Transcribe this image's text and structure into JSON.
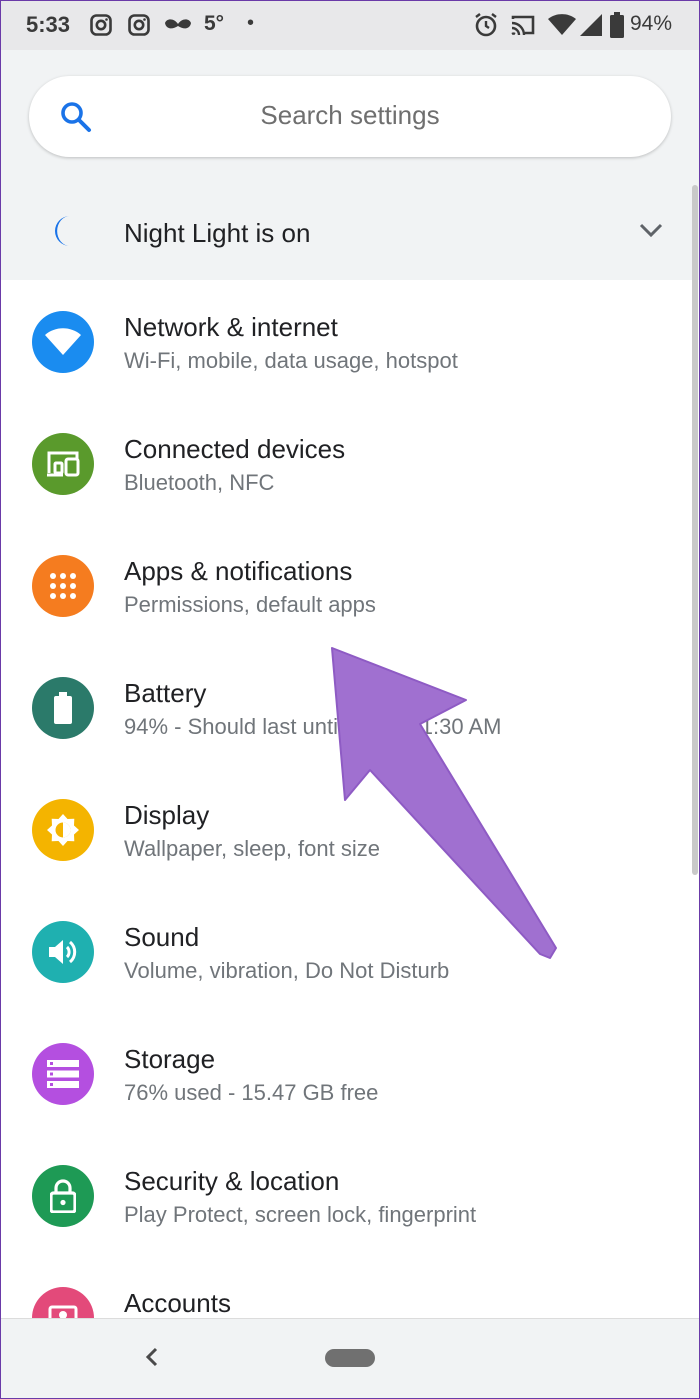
{
  "status_bar": {
    "time": "5:33",
    "temperature": "5°",
    "dot": "•",
    "battery": "94%",
    "icons_left": [
      "instagram-icon",
      "instagram-icon",
      "mustache-icon"
    ],
    "icons_right": [
      "alarm-icon",
      "cast-icon",
      "wifi-icon",
      "cellular-signal-icon",
      "battery-icon"
    ]
  },
  "search": {
    "placeholder": "Search settings",
    "icon": "search-icon"
  },
  "night_light": {
    "label": "Night Light is on",
    "icon": "moon-icon",
    "expand_icon": "chevron-down-icon",
    "accent": "#1a73e8"
  },
  "settings": [
    {
      "title": "Network & internet",
      "subtitle": "Wi-Fi, mobile, data usage, hotspot",
      "icon": "wifi-icon",
      "color": "#1a8cf0"
    },
    {
      "title": "Connected devices",
      "subtitle": "Bluetooth, NFC",
      "icon": "devices-icon",
      "color": "#5a9a2c"
    },
    {
      "title": "Apps & notifications",
      "subtitle": "Permissions, default apps",
      "icon": "apps-grid-icon",
      "color": "#f57c1f"
    },
    {
      "title": "Battery",
      "subtitle": "94% - Should last until about 11:30 AM",
      "icon": "battery-icon",
      "color": "#2b7a6a"
    },
    {
      "title": "Display",
      "subtitle": "Wallpaper, sleep, font size",
      "icon": "brightness-icon",
      "color": "#f4b400"
    },
    {
      "title": "Sound",
      "subtitle": "Volume, vibration, Do Not Disturb",
      "icon": "volume-icon",
      "color": "#1fb0b0"
    },
    {
      "title": "Storage",
      "subtitle": "76% used - 15.47 GB free",
      "icon": "storage-icon",
      "color": "#b44fe0"
    },
    {
      "title": "Security & location",
      "subtitle": "Play Protect, screen lock, fingerprint",
      "icon": "lock-icon",
      "color": "#1e9a55"
    },
    {
      "title": "Accounts",
      "subtitle": "",
      "icon": "account-icon",
      "color": "#e34a7a"
    }
  ],
  "annotation": {
    "arrow_color": "#a070d0"
  },
  "nav_bar": {
    "back_icon": "back-chevron-icon",
    "home_icon": "home-pill-icon"
  }
}
